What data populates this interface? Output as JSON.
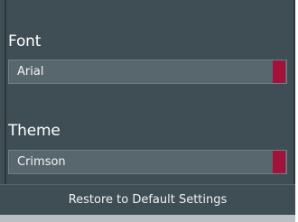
{
  "font_section": {
    "label": "Font",
    "value": "Arial"
  },
  "theme_section": {
    "label": "Theme",
    "value": "Crimson"
  },
  "restore_button": {
    "label": "Restore to Default Settings"
  },
  "colors": {
    "panel_background": "#3f4e54",
    "select_background": "#58676d",
    "accent": "#a3123a",
    "text": "#ffffff"
  }
}
